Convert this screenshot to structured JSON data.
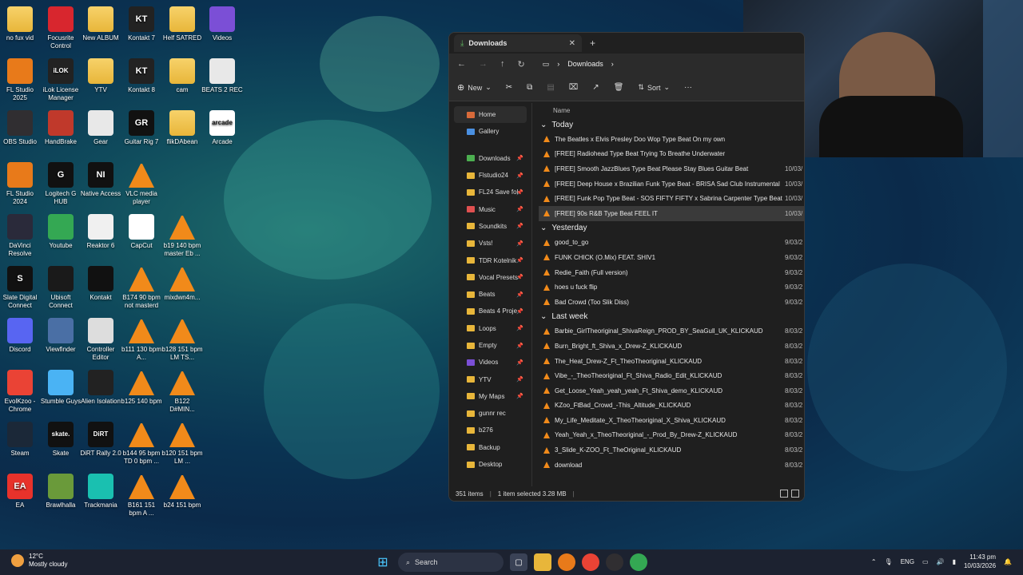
{
  "desktop_icons": [
    {
      "label": "no fux vid",
      "icon": "folder-icon",
      "type": "folder"
    },
    {
      "label": "Focusrite Control",
      "icon": "focusrite-icon",
      "type": "app",
      "color": "#d8262e"
    },
    {
      "label": "New ALBUM",
      "icon": "folder-icon",
      "type": "folder"
    },
    {
      "label": "Kontakt 7",
      "icon": "kontakt-icon",
      "type": "app",
      "color": "#222222",
      "text": "KT"
    },
    {
      "label": "Helf SATRED",
      "icon": "folder-icon",
      "type": "folder"
    },
    {
      "label": "Videos",
      "icon": "videos-icon",
      "type": "app",
      "color": "#7b4fd6"
    },
    {
      "label": "FL Studio 2025",
      "icon": "flstudio-icon",
      "type": "app",
      "color": "#e87a1a"
    },
    {
      "label": "iLok License Manager",
      "icon": "ilok-icon",
      "type": "app",
      "color": "#222222",
      "text": "iLOK"
    },
    {
      "label": "YTV",
      "icon": "folder-icon",
      "type": "folder"
    },
    {
      "label": "Kontakt 8",
      "icon": "kontakt-icon",
      "type": "app",
      "color": "#222222",
      "text": "KT"
    },
    {
      "label": "cam",
      "icon": "folder-icon",
      "type": "folder"
    },
    {
      "label": "BEATS 2 REC",
      "icon": "file-icon",
      "type": "app",
      "color": "#e8e8e8"
    },
    {
      "label": "OBS Studio",
      "icon": "obs-icon",
      "type": "app",
      "color": "#302e31"
    },
    {
      "label": "HandBrake",
      "icon": "handbrake-icon",
      "type": "app",
      "color": "#c0392b"
    },
    {
      "label": "Gear",
      "icon": "file-icon",
      "type": "app",
      "color": "#e8e8e8"
    },
    {
      "label": "Guitar Rig 7",
      "icon": "guitarrig-icon",
      "type": "app",
      "color": "#111111",
      "text": "GR"
    },
    {
      "label": "flikDAbean",
      "icon": "folder-icon",
      "type": "folder"
    },
    {
      "label": "Arcade",
      "icon": "arcade-icon",
      "type": "app",
      "color": "#ffffff",
      "text": "arcade"
    },
    {
      "label": "FL Studio 2024",
      "icon": "flstudio-icon",
      "type": "app",
      "color": "#e87a1a"
    },
    {
      "label": "Logitech G HUB",
      "icon": "logitech-icon",
      "type": "app",
      "color": "#111111",
      "text": "G"
    },
    {
      "label": "Native Access",
      "icon": "native-icon",
      "type": "app",
      "color": "#111111",
      "text": "NI"
    },
    {
      "label": "VLC media player",
      "icon": "vlc-icon",
      "type": "vlc"
    },
    {
      "label": "DaVinci Resolve",
      "icon": "davinci-icon",
      "type": "app",
      "color": "#2a2a3a"
    },
    {
      "label": "Youtube",
      "icon": "chrome-icon",
      "type": "app",
      "color": "#34a853"
    },
    {
      "label": "Reaktor 6",
      "icon": "reaktor-icon",
      "type": "app",
      "color": "#f0f0f0"
    },
    {
      "label": "CapCut",
      "icon": "capcut-icon",
      "type": "app",
      "color": "#ffffff"
    },
    {
      "label": "b19 140 bpm master Eb ...",
      "icon": "vlc-icon",
      "type": "vlc"
    },
    {
      "label": "Slate Digital Connect",
      "icon": "slate-icon",
      "type": "app",
      "color": "#111111",
      "text": "S"
    },
    {
      "label": "Ubisoft Connect",
      "icon": "ubisoft-icon",
      "type": "app",
      "color": "#1a1a1a"
    },
    {
      "label": "Kontakt",
      "icon": "kontakt-icon",
      "type": "app",
      "color": "#111111"
    },
    {
      "label": "B174 90 bpm not masterd",
      "icon": "vlc-icon",
      "type": "vlc"
    },
    {
      "label": "mixdwn4m...",
      "icon": "vlc-icon",
      "type": "vlc"
    },
    {
      "label": "Discord",
      "icon": "discord-icon",
      "type": "app",
      "color": "#5865f2"
    },
    {
      "label": "Viewfinder",
      "icon": "viewfinder-icon",
      "type": "app",
      "color": "#4a6fa5"
    },
    {
      "label": "Controller Editor",
      "icon": "controller-icon",
      "type": "app",
      "color": "#dddddd"
    },
    {
      "label": "b111 130 bpm A...",
      "icon": "vlc-icon",
      "type": "vlc"
    },
    {
      "label": "b128 151 bpm LM TS...",
      "icon": "vlc-icon",
      "type": "vlc"
    },
    {
      "label": "EvolKzoo - Chrome",
      "icon": "chrome-icon",
      "type": "app",
      "color": "#ea4335"
    },
    {
      "label": "Stumble Guys",
      "icon": "stumble-icon",
      "type": "app",
      "color": "#4ab3f4"
    },
    {
      "label": "Alien Isolation",
      "icon": "alien-icon",
      "type": "app",
      "color": "#222222"
    },
    {
      "label": "b125 140 bpm",
      "icon": "vlc-icon",
      "type": "vlc"
    },
    {
      "label": "B122 D#MIN...",
      "icon": "vlc-icon",
      "type": "vlc"
    },
    {
      "label": "Steam",
      "icon": "steam-icon",
      "type": "app",
      "color": "#1b2838"
    },
    {
      "label": "Skate",
      "icon": "skate-icon",
      "type": "app",
      "color": "#111111",
      "text": "skate."
    },
    {
      "label": "DiRT Rally 2.0",
      "icon": "dirt-icon",
      "type": "app",
      "color": "#111111",
      "text": "DiRT"
    },
    {
      "label": "b144 95 bpm TD 0 bpm ...",
      "icon": "vlc-icon",
      "type": "vlc"
    },
    {
      "label": "b120 151 bpm LM ...",
      "icon": "vlc-icon",
      "type": "vlc"
    },
    {
      "label": "EA",
      "icon": "ea-icon",
      "type": "app",
      "color": "#e8322b",
      "text": "EA"
    },
    {
      "label": "Brawlhalla",
      "icon": "brawlhalla-icon",
      "type": "app",
      "color": "#6a9a3a"
    },
    {
      "label": "Trackmania",
      "icon": "trackmania-icon",
      "type": "app",
      "color": "#1ac0b0"
    },
    {
      "label": "B161 151 bpm A ...",
      "icon": "vlc-icon",
      "type": "vlc"
    },
    {
      "label": "b24 151 bpm",
      "icon": "vlc-icon",
      "type": "vlc"
    }
  ],
  "explorer": {
    "tab_title": "Downloads",
    "breadcrumb": "Downloads",
    "toolbar": {
      "new_label": "New",
      "sort_label": "Sort"
    },
    "column_header": "Name",
    "nav_items": [
      {
        "label": "Home",
        "icon": "home-icon",
        "pinned": false
      },
      {
        "label": "Gallery",
        "icon": "gallery-icon",
        "pinned": false
      },
      {
        "label": "Downloads",
        "icon": "download-icon",
        "pinned": true
      },
      {
        "label": "Flstudio24",
        "icon": "folder-icon",
        "pinned": true
      },
      {
        "label": "FL24 Save fol",
        "icon": "folder-icon",
        "pinned": true
      },
      {
        "label": "Music",
        "icon": "music-icon",
        "pinned": true
      },
      {
        "label": "Soundkits",
        "icon": "folder-icon",
        "pinned": true
      },
      {
        "label": "Vsts!",
        "icon": "folder-icon",
        "pinned": true
      },
      {
        "label": "TDR Kotelnik",
        "icon": "folder-icon",
        "pinned": true
      },
      {
        "label": "Vocal Presets",
        "icon": "folder-icon",
        "pinned": true
      },
      {
        "label": "Beats",
        "icon": "folder-icon",
        "pinned": true
      },
      {
        "label": "Beats 4 Proje",
        "icon": "folder-icon",
        "pinned": true
      },
      {
        "label": "Loops",
        "icon": "folder-icon",
        "pinned": true
      },
      {
        "label": "Empty",
        "icon": "folder-icon",
        "pinned": true
      },
      {
        "label": "Videos",
        "icon": "videos-icon",
        "pinned": true
      },
      {
        "label": "YTV",
        "icon": "folder-icon",
        "pinned": true
      },
      {
        "label": "My Maps",
        "icon": "folder-icon",
        "pinned": true
      },
      {
        "label": "gunnr rec",
        "icon": "folder-icon",
        "pinned": false
      },
      {
        "label": "b276",
        "icon": "folder-icon",
        "pinned": false
      },
      {
        "label": "Backup",
        "icon": "folder-icon",
        "pinned": false
      },
      {
        "label": "Desktop",
        "icon": "folder-icon",
        "pinned": false
      }
    ],
    "groups": [
      {
        "title": "Today",
        "files": [
          {
            "name": "The Beatles x Elvis Presley Doo Wop Type Beat  On my own",
            "date": ""
          },
          {
            "name": "[FREE] Radiohead Type Beat  Trying To Breathe Underwater",
            "date": ""
          },
          {
            "name": "[FREE] Smooth JazzBlues Type Beat  Please Stay  Blues Guitar Beat",
            "date": "10/03/"
          },
          {
            "name": "[FREE] Deep House x Brazilian Funk Type Beat - BRISA  Sad Club Instrumental",
            "date": "10/03/"
          },
          {
            "name": "[FREE] Funk Pop Type Beat - SOS  FIFTY FIFTY x Sabrina Carpenter Type Beat",
            "date": "10/03/"
          },
          {
            "name": "[FREE] 90s R&B Type Beat FEEL IT",
            "date": "10/03/",
            "selected": true
          }
        ]
      },
      {
        "title": "Yesterday",
        "files": [
          {
            "name": "good_to_go",
            "date": "9/03/2"
          },
          {
            "name": "FUNK CHICK (O.Mix) FEAT. SHIV1",
            "date": "9/03/2"
          },
          {
            "name": "Redie_Faith (Full version)",
            "date": "9/03/2"
          },
          {
            "name": "hoes u fuck flip",
            "date": "9/03/2"
          },
          {
            "name": "Bad Crowd (Too Slik Diss)",
            "date": "9/03/2"
          }
        ]
      },
      {
        "title": "Last week",
        "files": [
          {
            "name": "Barbie_GirlTheoriginal_ShivaReign_PROD_BY_SeaGull_UK_KLICKAUD",
            "date": "8/03/2"
          },
          {
            "name": "Burn_Bright_ft_Shiva_x_Drew-Z_KLICKAUD",
            "date": "8/03/2"
          },
          {
            "name": "The_Heat_Drew-Z_Ft_TheoTheoriginal_KLICKAUD",
            "date": "8/03/2"
          },
          {
            "name": "Vibe_-_TheoTheoriginal_Ft_Shiva_Radio_Edit_KLICKAUD",
            "date": "8/03/2"
          },
          {
            "name": "Get_Loose_Yeah_yeah_yeah_Ft_Shiva_demo_KLICKAUD",
            "date": "8/03/2"
          },
          {
            "name": "KZoo_FtBad_Crowd_-This_Altitude_KLICKAUD",
            "date": "8/03/2"
          },
          {
            "name": "My_Life_Meditate_X_TheoTheoriginal_X_Shiva_KLICKAUD",
            "date": "8/03/2"
          },
          {
            "name": "Yeah_Yeah_x_TheoTheoriginal_-_Prod_By_Drew-Z_KLICKAUD",
            "date": "8/03/2"
          },
          {
            "name": "3_Slide_K-ZOO_Ft_TheOriginal_KLICKAUD",
            "date": "8/03/2"
          },
          {
            "name": "download",
            "date": "8/03/2"
          }
        ]
      }
    ],
    "status": {
      "count": "351 items",
      "selected": "1 item selected  3.28 MB"
    }
  },
  "taskbar": {
    "weather_temp": "12°C",
    "weather_desc": "Mostly cloudy",
    "search_label": "Search",
    "lang": "ENG",
    "time": "11:43 pm",
    "date": "10/03/2026"
  }
}
